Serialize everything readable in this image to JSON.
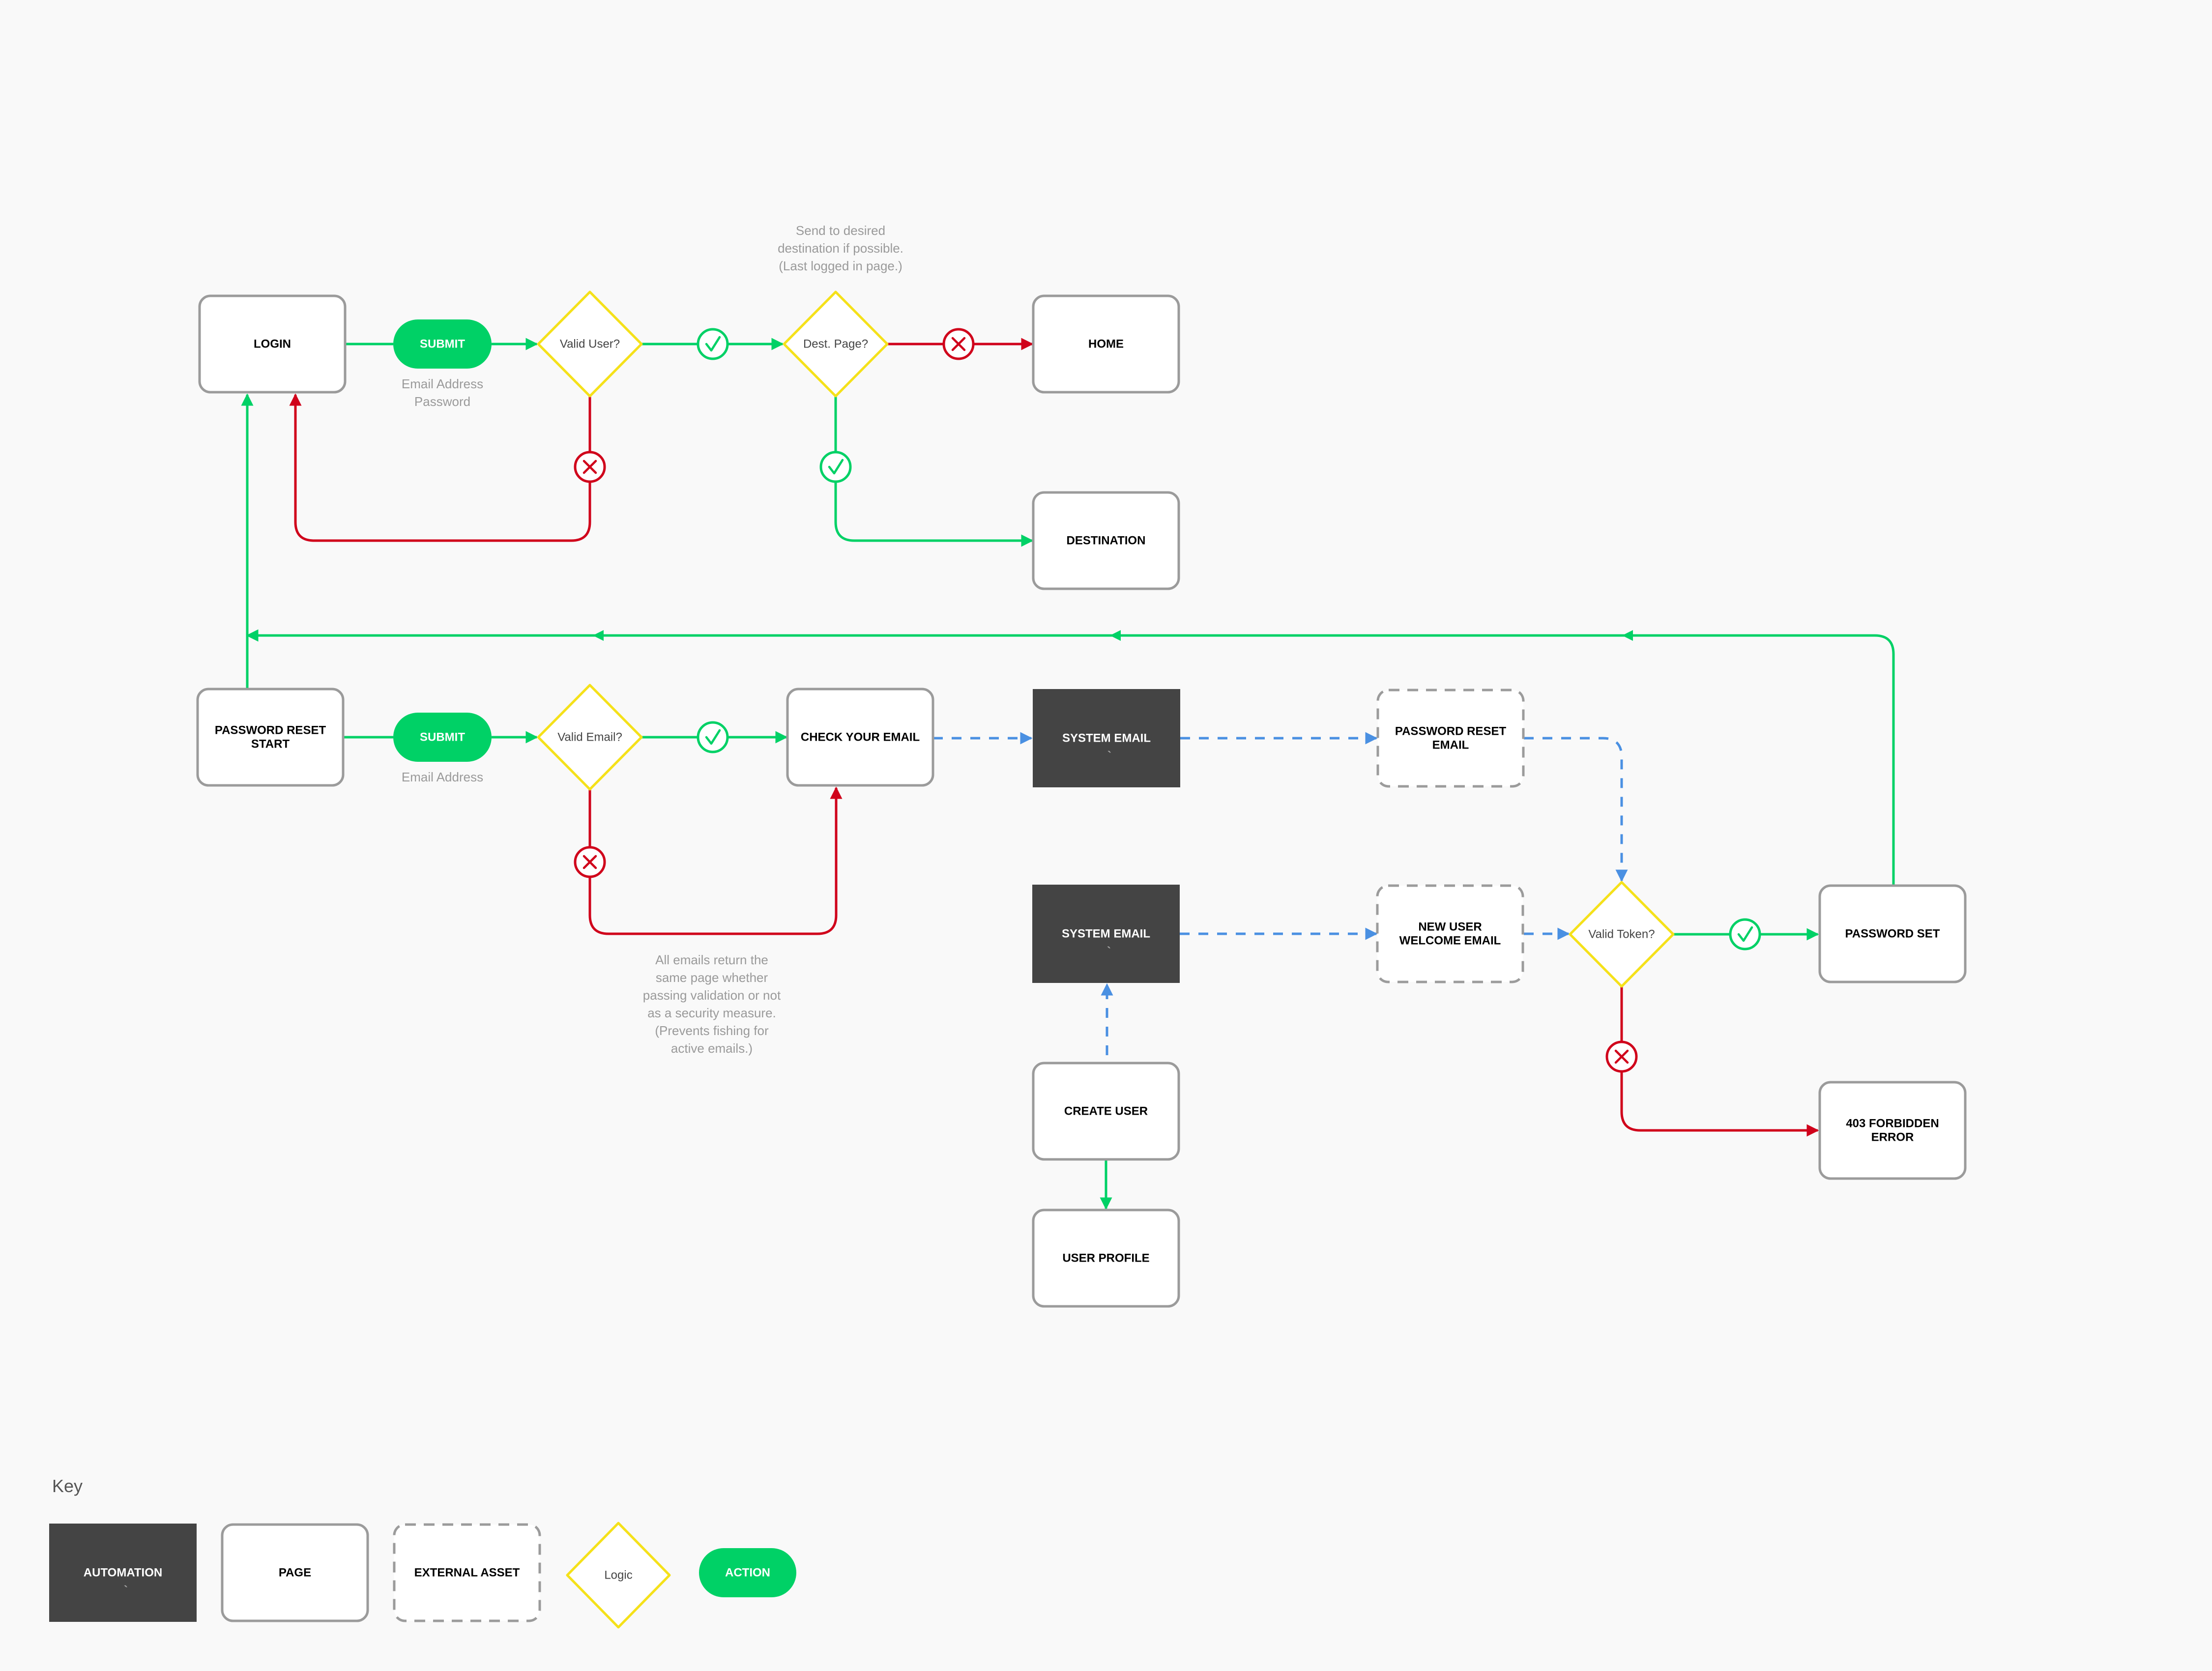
{
  "colors": {
    "background": "#f9f9f9",
    "page_border": "#9b9b9b",
    "page_fill": "#ffffff",
    "automation_fill": "#444444",
    "logic_border": "#f5e11a",
    "action_fill": "#00d166",
    "success": "#00d166",
    "failure": "#d0021b",
    "email_flow": "#4a90e2",
    "note_text": "#9a9a9a",
    "label_dark": "#000000",
    "label_logic": "#444444"
  },
  "nodes": [
    {
      "id": "login",
      "type": "page",
      "label": [
        "LOGIN"
      ]
    },
    {
      "id": "submit-login",
      "type": "action",
      "label": [
        "SUBMIT"
      ],
      "caption": [
        "Email Address",
        "Password"
      ]
    },
    {
      "id": "valid-user",
      "type": "logic",
      "label": [
        "Valid User?"
      ]
    },
    {
      "id": "dest-page",
      "type": "logic",
      "label": [
        "Dest. Page?"
      ]
    },
    {
      "id": "home",
      "type": "page",
      "label": [
        "HOME"
      ]
    },
    {
      "id": "destination",
      "type": "page",
      "label": [
        "DESTINATION"
      ]
    },
    {
      "id": "password-reset-start",
      "type": "page",
      "label": [
        "PASSWORD RESET",
        "START"
      ]
    },
    {
      "id": "submit-reset",
      "type": "action",
      "label": [
        "SUBMIT"
      ],
      "caption": [
        "Email Address"
      ]
    },
    {
      "id": "valid-email",
      "type": "logic",
      "label": [
        "Valid Email?"
      ]
    },
    {
      "id": "check-your-email",
      "type": "page",
      "label": [
        "CHECK YOUR EMAIL"
      ]
    },
    {
      "id": "system-email-1",
      "type": "automation",
      "label": [
        "SYSTEM EMAIL"
      ],
      "sub": "`"
    },
    {
      "id": "password-reset-email",
      "type": "external",
      "label": [
        "PASSWORD RESET",
        "EMAIL"
      ]
    },
    {
      "id": "system-email-2",
      "type": "automation",
      "label": [
        "SYSTEM EMAIL"
      ],
      "sub": "`"
    },
    {
      "id": "new-user-welcome-email",
      "type": "external",
      "label": [
        "NEW USER",
        "WELCOME EMAIL"
      ]
    },
    {
      "id": "valid-token",
      "type": "logic",
      "label": [
        "Valid Token?"
      ]
    },
    {
      "id": "password-set",
      "type": "page",
      "label": [
        "PASSWORD SET"
      ]
    },
    {
      "id": "forbidden-error",
      "type": "page",
      "label": [
        "403 FORBIDDEN",
        "ERROR"
      ]
    },
    {
      "id": "create-user",
      "type": "page",
      "label": [
        "CREATE USER"
      ]
    },
    {
      "id": "user-profile",
      "type": "page",
      "label": [
        "USER PROFILE"
      ]
    }
  ],
  "edges": [
    {
      "from": "login",
      "to": "submit-login",
      "kind": "success",
      "marker": "none"
    },
    {
      "from": "submit-login",
      "to": "valid-user",
      "kind": "success",
      "marker": "none"
    },
    {
      "from": "valid-user",
      "to": "dest-page",
      "kind": "success",
      "marker": "check"
    },
    {
      "from": "valid-user",
      "to": "login",
      "kind": "failure",
      "marker": "cross"
    },
    {
      "from": "dest-page",
      "to": "home",
      "kind": "failure",
      "marker": "cross"
    },
    {
      "from": "dest-page",
      "to": "destination",
      "kind": "success",
      "marker": "check"
    },
    {
      "from": "password-reset-start",
      "to": "login",
      "kind": "success",
      "marker": "none"
    },
    {
      "from": "password-reset-start",
      "to": "submit-reset",
      "kind": "success",
      "marker": "none"
    },
    {
      "from": "submit-reset",
      "to": "valid-email",
      "kind": "success",
      "marker": "none"
    },
    {
      "from": "valid-email",
      "to": "check-your-email",
      "kind": "success",
      "marker": "check"
    },
    {
      "from": "valid-email",
      "to": "check-your-email",
      "kind": "failure",
      "marker": "cross"
    },
    {
      "from": "check-your-email",
      "to": "system-email-1",
      "kind": "email",
      "marker": "none"
    },
    {
      "from": "system-email-1",
      "to": "password-reset-email",
      "kind": "email",
      "marker": "none"
    },
    {
      "from": "password-reset-email",
      "to": "valid-token",
      "kind": "email",
      "marker": "none"
    },
    {
      "from": "system-email-2",
      "to": "new-user-welcome-email",
      "kind": "email",
      "marker": "none"
    },
    {
      "from": "new-user-welcome-email",
      "to": "valid-token",
      "kind": "email",
      "marker": "none"
    },
    {
      "from": "create-user",
      "to": "system-email-2",
      "kind": "email",
      "marker": "none"
    },
    {
      "from": "create-user",
      "to": "user-profile",
      "kind": "success",
      "marker": "none"
    },
    {
      "from": "valid-token",
      "to": "password-set",
      "kind": "success",
      "marker": "check"
    },
    {
      "from": "valid-token",
      "to": "forbidden-error",
      "kind": "failure",
      "marker": "cross"
    },
    {
      "from": "password-set",
      "to": "login",
      "kind": "success",
      "marker": "none"
    }
  ],
  "notes": {
    "dest_page_note": [
      "Send to desired",
      "destination if possible.",
      "(Last logged in page.)"
    ],
    "valid_email_note": [
      "All emails return the",
      "same page whether",
      "passing validation or not",
      "as a security measure.",
      "(Prevents fishing for",
      "active emails.)"
    ]
  },
  "key": {
    "title": "Key",
    "items": [
      {
        "type": "automation",
        "label": "AUTOMATION"
      },
      {
        "type": "page",
        "label": "PAGE"
      },
      {
        "type": "external",
        "label": "EXTERNAL ASSET"
      },
      {
        "type": "logic",
        "label": "Logic"
      },
      {
        "type": "action",
        "label": "ACTION"
      }
    ]
  }
}
